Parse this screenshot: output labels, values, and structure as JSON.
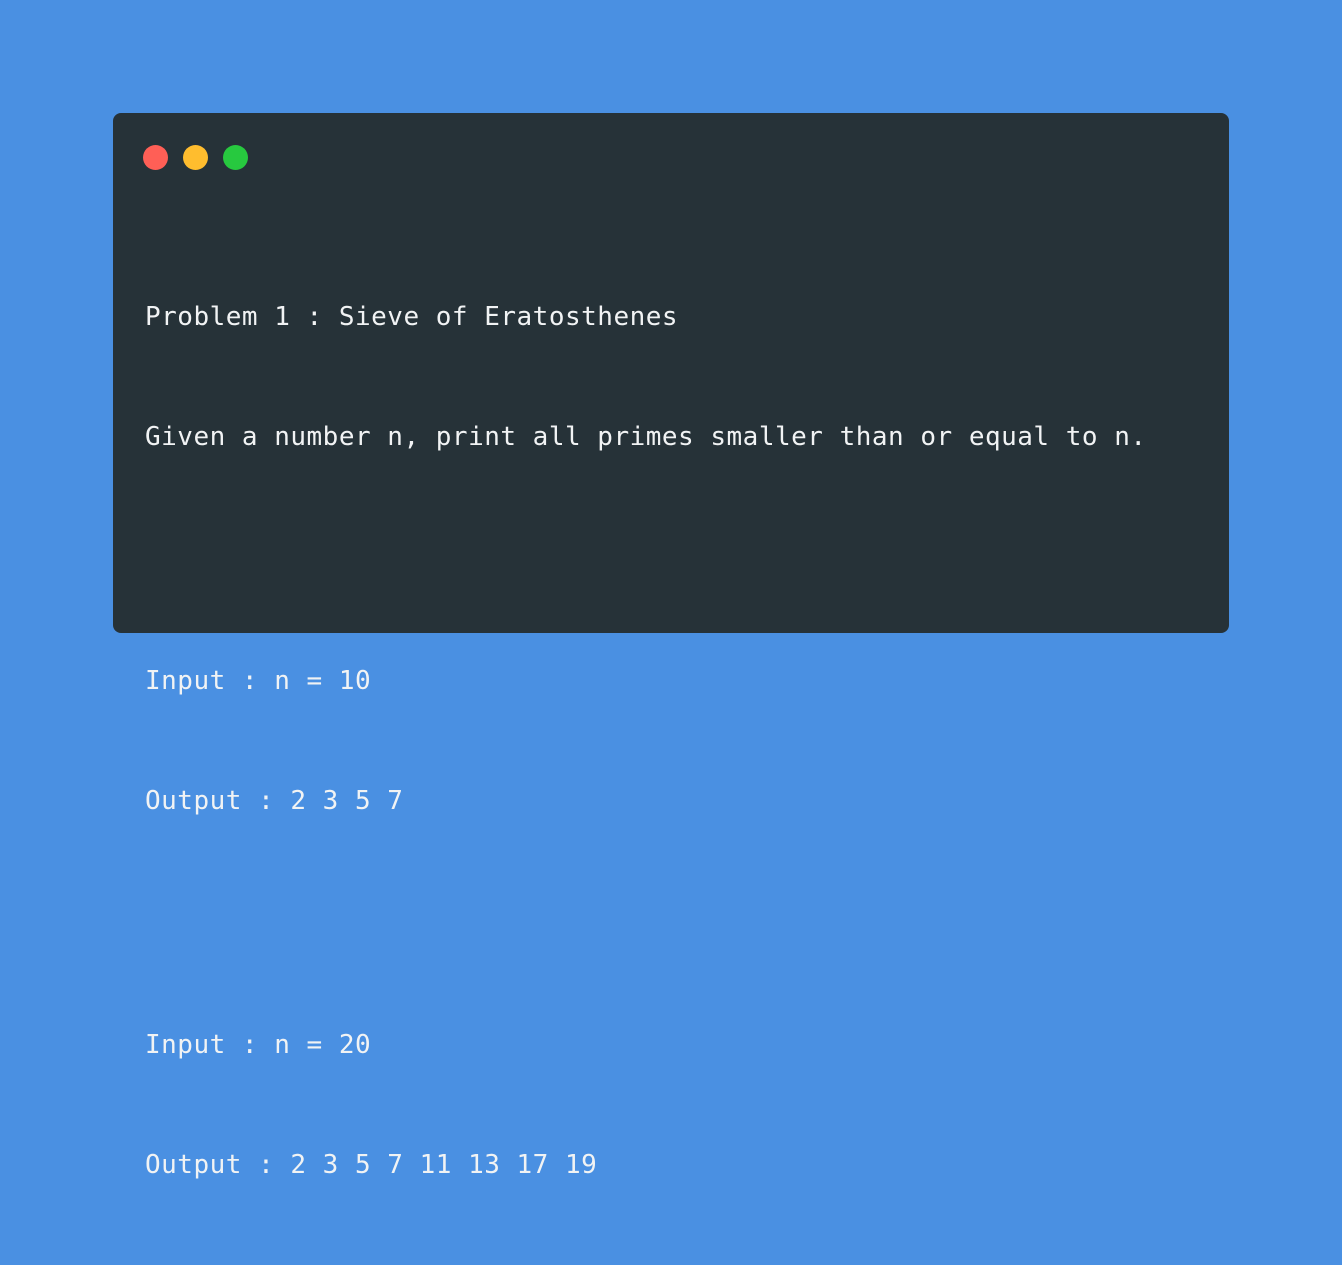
{
  "window": {
    "controls": [
      {
        "name": "close",
        "color": "#ff5f56"
      },
      {
        "name": "minimize",
        "color": "#ffbd2e"
      },
      {
        "name": "maximize",
        "color": "#27c93f"
      }
    ]
  },
  "code": {
    "lines": [
      "Problem 1 : Sieve of Eratosthenes",
      "Given a number n, print all primes smaller than or equal to n.",
      "",
      "Input : n = 10",
      "Output : 2 3 5 7",
      "",
      "Input : n = 20",
      "Output : 2 3 5 7 11 13 17 19"
    ]
  }
}
